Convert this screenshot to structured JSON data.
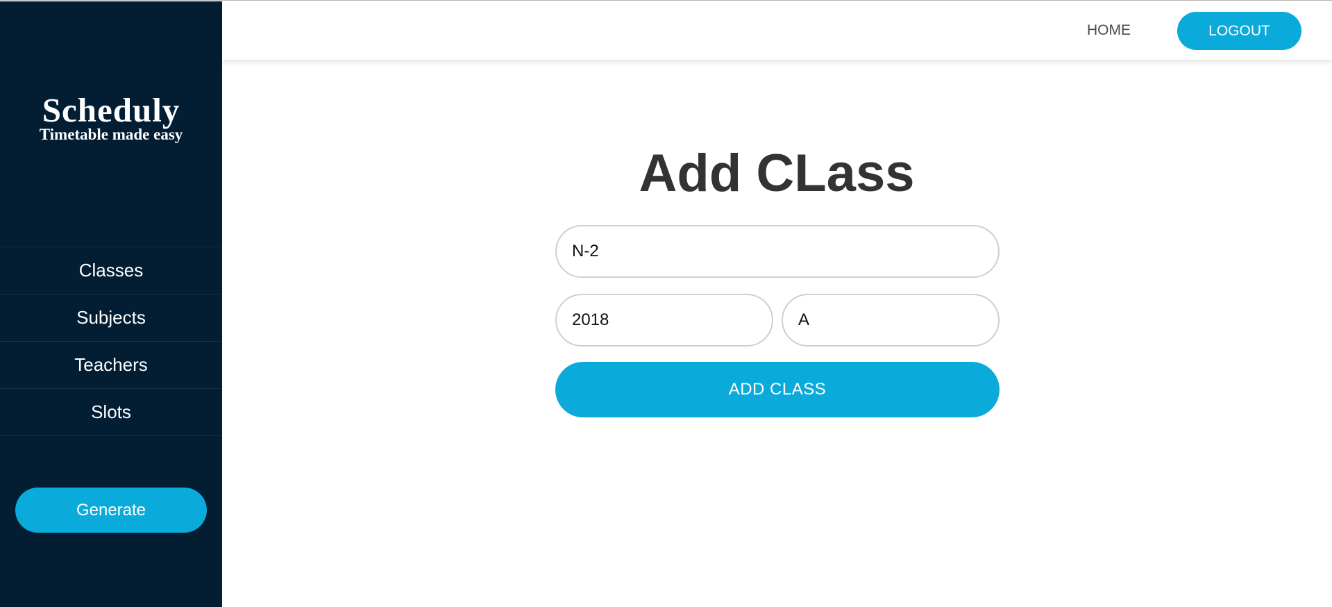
{
  "brand": {
    "name": "Scheduly",
    "tagline": "Timetable made easy"
  },
  "sidebar": {
    "items": [
      {
        "label": "Classes"
      },
      {
        "label": "Subjects"
      },
      {
        "label": "Teachers"
      },
      {
        "label": "Slots"
      }
    ],
    "generate_label": "Generate"
  },
  "topbar": {
    "home_label": "HOME",
    "logout_label": "LOGOUT"
  },
  "form": {
    "title": "Add CLass",
    "class_name_value": "N-2",
    "year_value": "2018",
    "section_value": "A",
    "submit_label": "ADD CLASS"
  },
  "colors": {
    "sidebar_bg": "#031d33",
    "accent": "#0aabdb",
    "title_text": "#333333"
  }
}
